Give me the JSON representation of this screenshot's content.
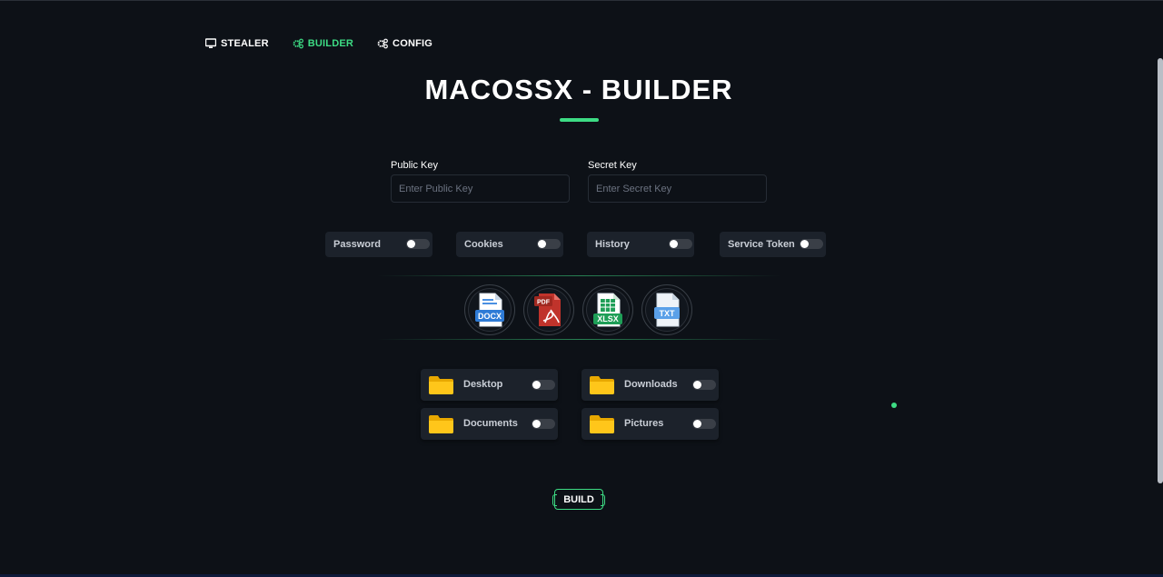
{
  "nav": [
    {
      "label": "STEALER",
      "icon": "monitor-icon",
      "active": false
    },
    {
      "label": "BUILDER",
      "icon": "cogs-icon",
      "active": true
    },
    {
      "label": "CONFIG",
      "icon": "cogs-icon",
      "active": false
    }
  ],
  "title": "MACOSSX - BUILDER",
  "colors": {
    "accent": "#3ddc84",
    "background": "#0d1117",
    "card": "#1c222b"
  },
  "fields": {
    "public_key": {
      "label": "Public Key",
      "placeholder": "Enter Public Key",
      "value": ""
    },
    "secret_key": {
      "label": "Secret Key",
      "placeholder": "Enter Secret Key",
      "value": ""
    }
  },
  "options": [
    {
      "label": "Password",
      "enabled": false
    },
    {
      "label": "Cookies",
      "enabled": false
    },
    {
      "label": "History",
      "enabled": false
    },
    {
      "label": "Service Token",
      "enabled": false
    }
  ],
  "file_types": [
    {
      "label": "DOCX",
      "icon": "docx-file-icon"
    },
    {
      "label": "PDF",
      "icon": "pdf-file-icon"
    },
    {
      "label": "XLSX",
      "icon": "xlsx-file-icon"
    },
    {
      "label": "TXT",
      "icon": "txt-file-icon"
    }
  ],
  "folders": [
    {
      "label": "Desktop",
      "enabled": false
    },
    {
      "label": "Downloads",
      "enabled": false
    },
    {
      "label": "Documents",
      "enabled": false
    },
    {
      "label": "Pictures",
      "enabled": false
    }
  ],
  "build_label": "BUILD"
}
